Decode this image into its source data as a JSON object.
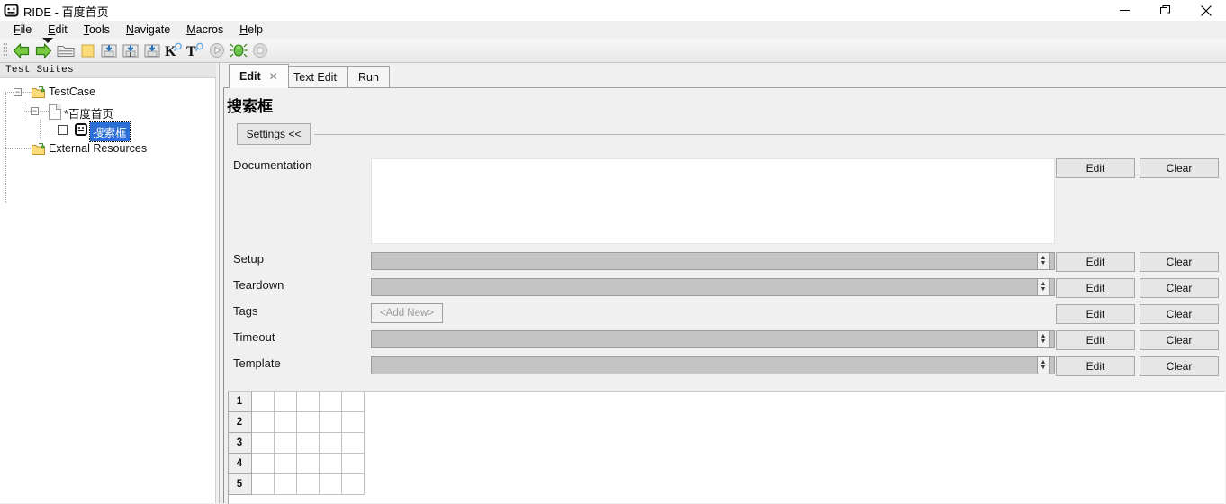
{
  "window": {
    "title": "RIDE - 百度首页",
    "icon": "robot-icon",
    "minimize": "—",
    "maximize": "❐",
    "close": "✕"
  },
  "menubar": {
    "items": [
      {
        "mnemonic": "F",
        "rest": "ile"
      },
      {
        "mnemonic": "E",
        "rest": "dit"
      },
      {
        "mnemonic": "T",
        "rest": "ools"
      },
      {
        "mnemonic": "N",
        "rest": "avigate"
      },
      {
        "mnemonic": "M",
        "rest": "acros"
      },
      {
        "mnemonic": "H",
        "rest": "elp"
      }
    ]
  },
  "toolbar": {
    "items": [
      {
        "name": "back-arrow-icon"
      },
      {
        "name": "forward-arrow-icon"
      },
      {
        "name": "open-folder-icon"
      },
      {
        "name": "new-folder-icon"
      },
      {
        "name": "save-icon"
      },
      {
        "name": "save-as-icon"
      },
      {
        "name": "save-all-icon"
      },
      {
        "name": "search-keyword-icon"
      },
      {
        "name": "search-test-icon"
      },
      {
        "name": "run-icon"
      },
      {
        "name": "debug-icon"
      },
      {
        "name": "stop-icon"
      }
    ]
  },
  "sidebar": {
    "header": "Test Suites",
    "tree": [
      {
        "label": "TestCase",
        "icon": "suite-folder-icon",
        "expanded": true,
        "selected": false
      },
      {
        "label": "*百度首页",
        "icon": "file-icon",
        "expanded": true,
        "selected": false
      },
      {
        "label": "搜索框",
        "icon": "testcase-robot-icon",
        "expanded": false,
        "selected": true
      },
      {
        "label": "External Resources",
        "icon": "suite-folder-icon",
        "expanded": false,
        "selected": false
      }
    ]
  },
  "tabs": [
    {
      "label": "Edit",
      "active": true,
      "closable": true,
      "close_glyph": "✕"
    },
    {
      "label": "Text Edit",
      "active": false,
      "closable": false
    },
    {
      "label": "Run",
      "active": false,
      "closable": false
    }
  ],
  "editor": {
    "testcase_title": "搜索框",
    "settings_toggle": "Settings <<",
    "fields": [
      {
        "label": "Documentation",
        "type": "textarea",
        "value": "",
        "edit": "Edit",
        "clear": "Clear"
      },
      {
        "label": "Setup",
        "type": "text-spin",
        "value": "",
        "edit": "Edit",
        "clear": "Clear"
      },
      {
        "label": "Teardown",
        "type": "text-spin",
        "value": "",
        "edit": "Edit",
        "clear": "Clear"
      },
      {
        "label": "Tags",
        "type": "tags",
        "value": "<Add New>",
        "edit": "Edit",
        "clear": "Clear"
      },
      {
        "label": "Timeout",
        "type": "text-spin",
        "value": "",
        "edit": "Edit",
        "clear": "Clear"
      },
      {
        "label": "Template",
        "type": "text-spin",
        "value": "",
        "edit": "Edit",
        "clear": "Clear"
      }
    ],
    "grid": {
      "row_numbers": [
        "1",
        "2",
        "3",
        "4",
        "5"
      ],
      "columns": 5,
      "cells": [
        [
          "",
          "",
          "",
          "",
          ""
        ],
        [
          "",
          "",
          "",
          "",
          ""
        ],
        [
          "",
          "",
          "",
          "",
          ""
        ],
        [
          "",
          "",
          "",
          "",
          ""
        ],
        [
          "",
          "",
          "",
          "",
          ""
        ]
      ]
    }
  },
  "colors": {
    "selection": "#2a6fd6",
    "window_bg": "#f0f0f0",
    "field_bg": "#c4c4c4",
    "accent_green": "#5ab52a"
  }
}
